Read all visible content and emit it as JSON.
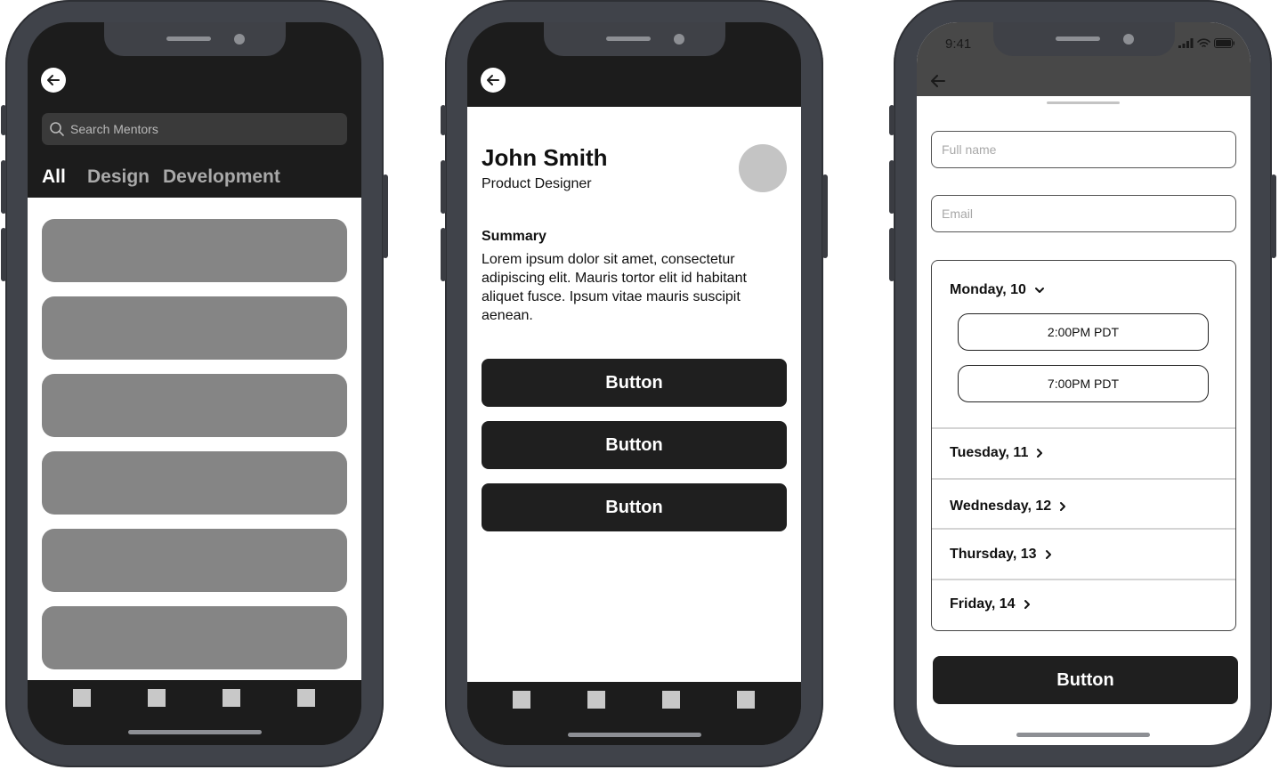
{
  "phone1": {
    "search_placeholder": "Search Mentors",
    "categories": [
      "All",
      "Design",
      "Development"
    ]
  },
  "phone2": {
    "name": "John Smith",
    "role": "Product Designer",
    "summary_heading": "Summary",
    "summary_text": "Lorem ipsum dolor sit amet, consectetur adipiscing elit. Mauris tortor elit id habitant aliquet fusce. Ipsum vitae mauris suscipit aenean.",
    "buttons": [
      "Button",
      "Button",
      "Button"
    ]
  },
  "phone3": {
    "time": "9:41",
    "fullname_placeholder": "Full name",
    "email_placeholder": "Email",
    "days": [
      "Monday, 10",
      "Tuesday, 11",
      "Wednesday, 12",
      "Thursday, 13",
      "Friday, 14"
    ],
    "slots": [
      "2:00PM PDT",
      "7:00PM PDT"
    ],
    "submit_label": "Button"
  },
  "colors": {
    "frame": "#40434a",
    "dark": "#1c1c1c",
    "card": "#858585",
    "tab_inactive": "#b0b0b0"
  }
}
